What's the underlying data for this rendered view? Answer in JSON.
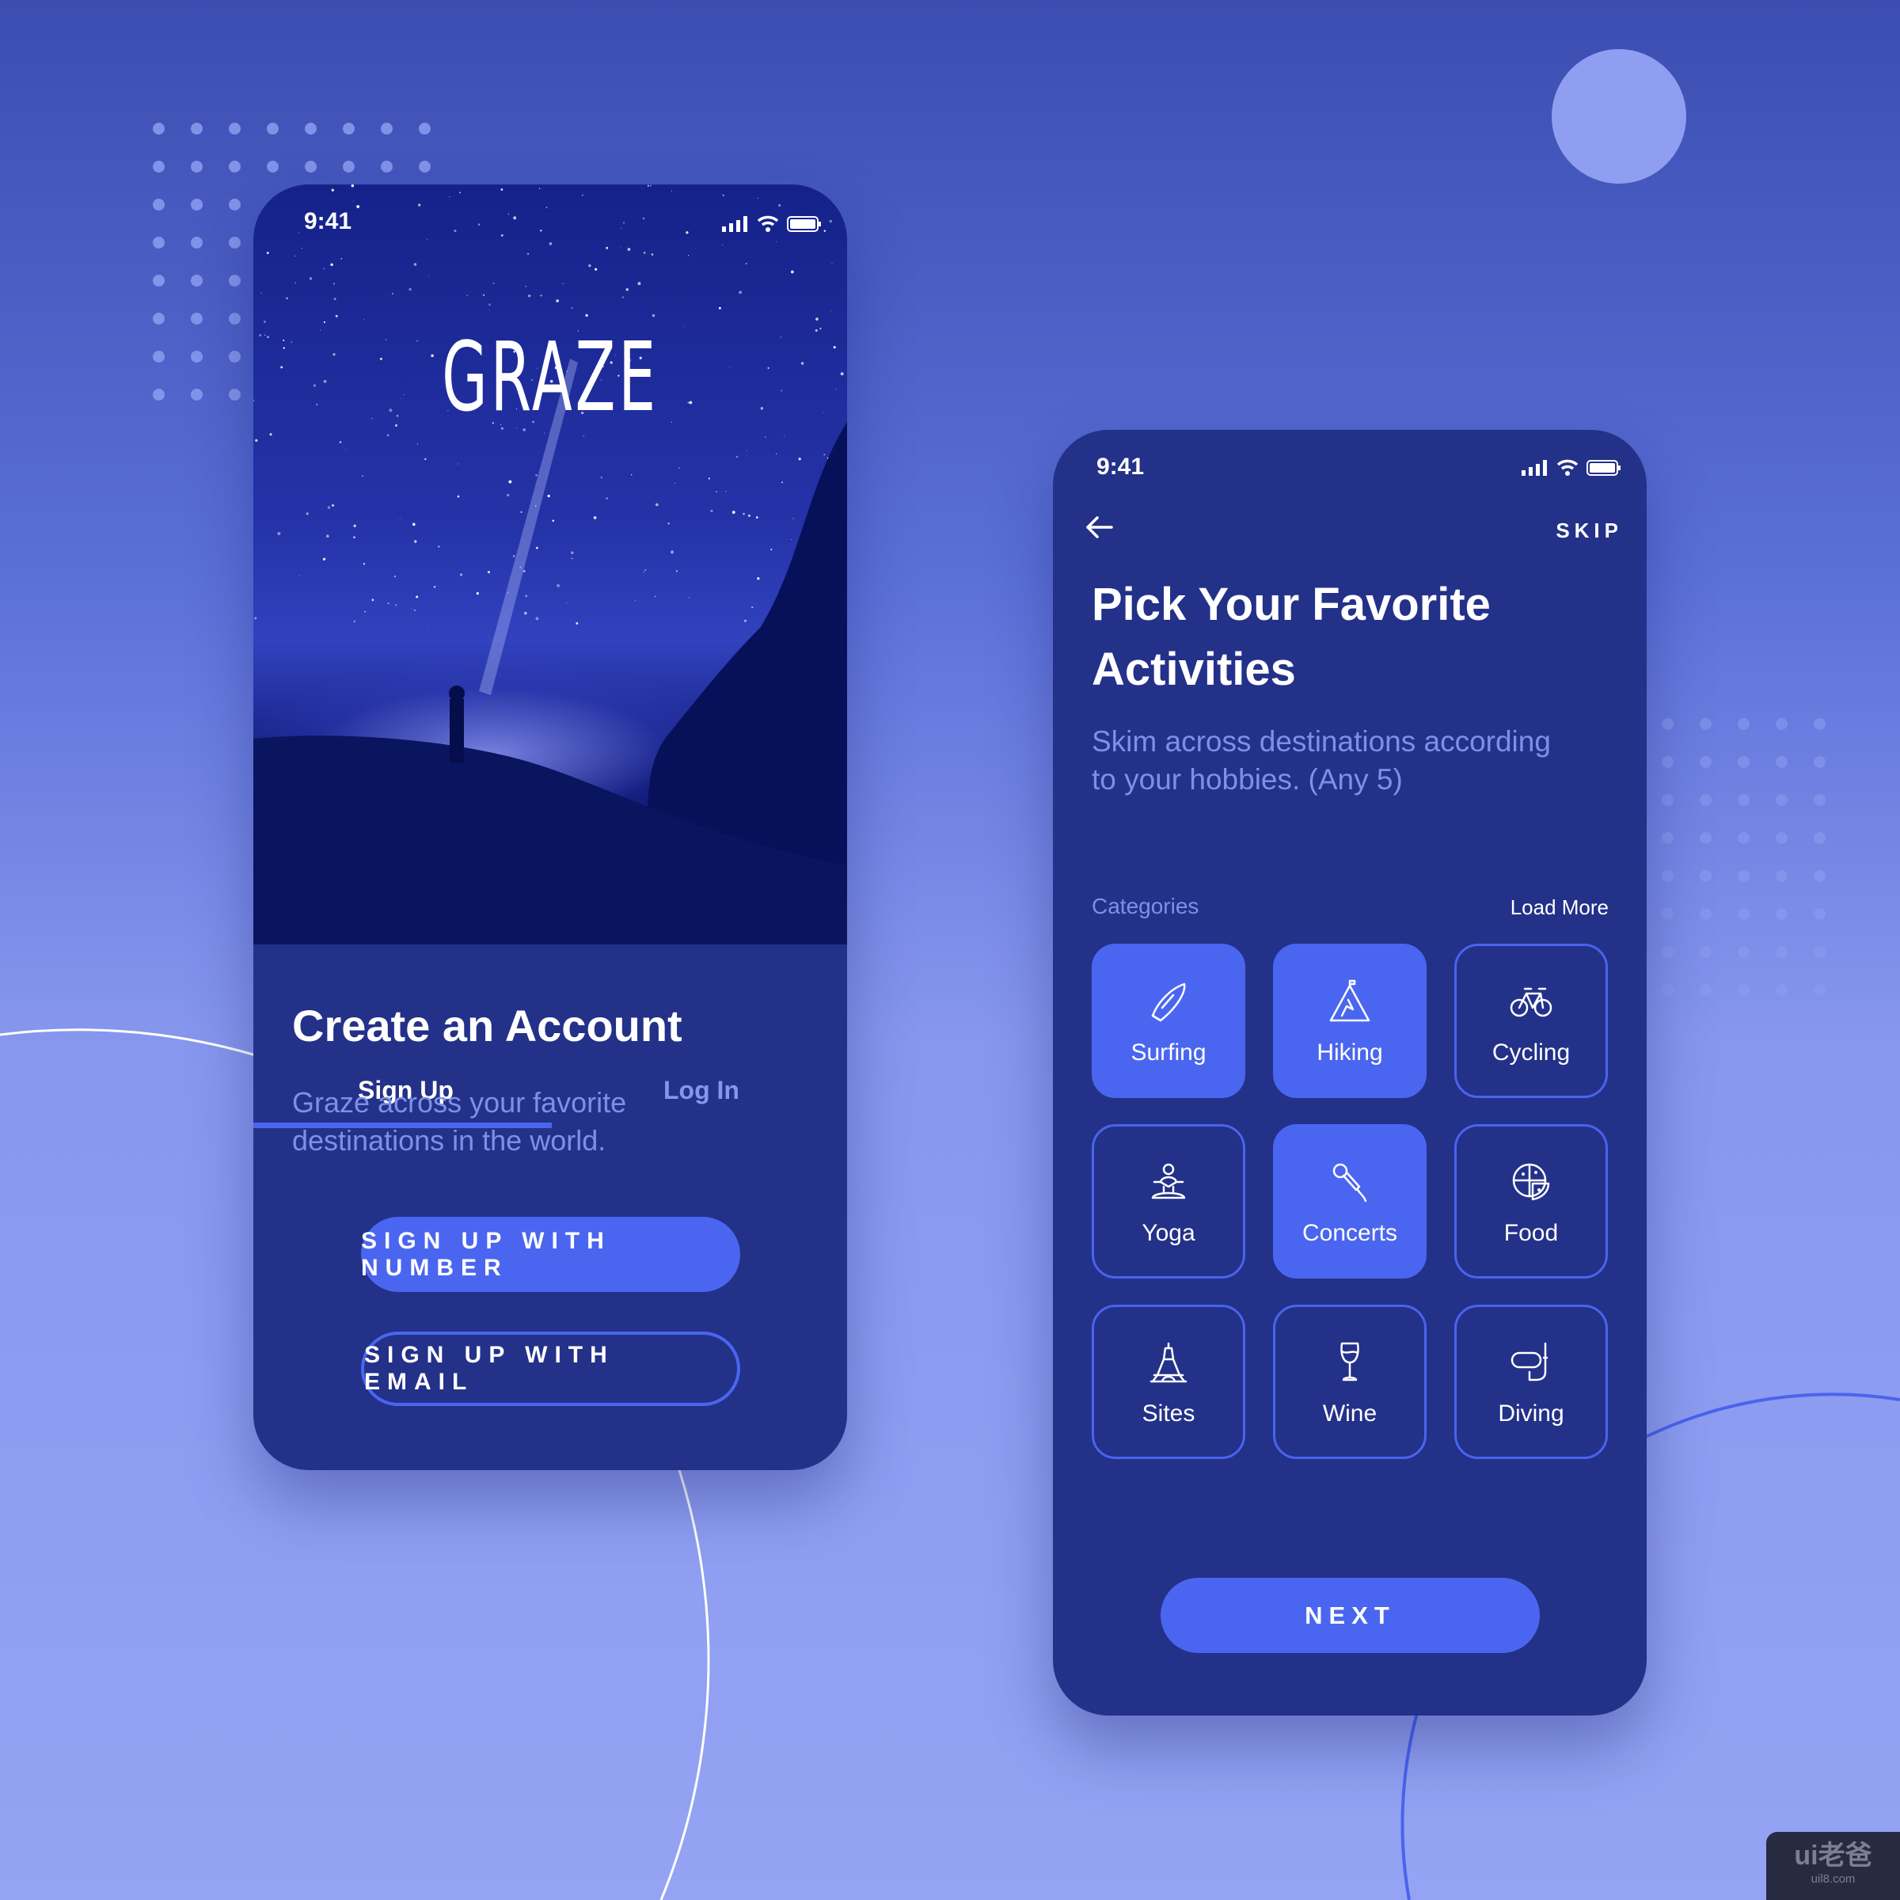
{
  "colors": {
    "accent": "#4a66f0",
    "card": "#233189",
    "muted": "#7f8fe8",
    "bg_top": "#3b4db0",
    "bg_bottom": "#94a3f3"
  },
  "signup_screen": {
    "status_time": "9:41",
    "logo": "GRAZE",
    "tabs": [
      {
        "label": "Sign Up",
        "active": true
      },
      {
        "label": "Log In",
        "active": false
      }
    ],
    "title": "Create an Account",
    "subtitle_lines": [
      "Graze across your favorite",
      "destinations in the world."
    ],
    "primary_button": "SIGN UP WITH NUMBER",
    "secondary_button": "SIGN UP WITH EMAIL"
  },
  "activities_screen": {
    "status_time": "9:41",
    "back_icon": "arrow-left-icon",
    "skip": "SKIP",
    "title_lines": [
      "Pick Your Favorite",
      "Activities"
    ],
    "subtitle_lines": [
      "Skim across destinations according",
      "to your hobbies. (Any 5)"
    ],
    "categories_label": "Categories",
    "load_more": "Load More",
    "categories": [
      {
        "label": "Surfing",
        "icon": "surfboard-icon",
        "selected": true
      },
      {
        "label": "Hiking",
        "icon": "mountain-icon",
        "selected": true
      },
      {
        "label": "Cycling",
        "icon": "bicycle-icon",
        "selected": false
      },
      {
        "label": "Yoga",
        "icon": "yoga-icon",
        "selected": false
      },
      {
        "label": "Concerts",
        "icon": "microphone-icon",
        "selected": true
      },
      {
        "label": "Food",
        "icon": "pizza-icon",
        "selected": false
      },
      {
        "label": "Sites",
        "icon": "eiffel-tower-icon",
        "selected": false
      },
      {
        "label": "Wine",
        "icon": "wine-glass-icon",
        "selected": false
      },
      {
        "label": "Diving",
        "icon": "diving-mask-icon",
        "selected": false
      }
    ],
    "next_button": "NEXT"
  },
  "watermark": {
    "logo": "ui老爸",
    "url": "uil8.com"
  }
}
